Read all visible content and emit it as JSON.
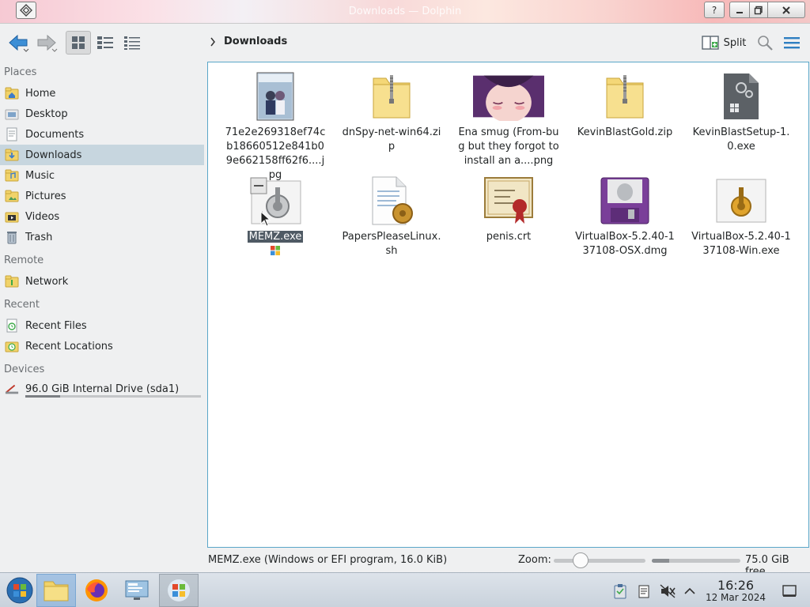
{
  "window": {
    "title": "Downloads — Dolphin"
  },
  "toolbar": {
    "breadcrumb": [
      "Downloads"
    ],
    "split_label": "Split"
  },
  "sidebar": {
    "sections": [
      {
        "title": "Places",
        "items": [
          "Home",
          "Desktop",
          "Documents",
          "Downloads",
          "Music",
          "Pictures",
          "Videos",
          "Trash"
        ]
      },
      {
        "title": "Remote",
        "items": [
          "Network"
        ]
      },
      {
        "title": "Recent",
        "items": [
          "Recent Files",
          "Recent Locations"
        ]
      },
      {
        "title": "Devices",
        "items": [
          "96.0 GiB Internal Drive (sda1)"
        ]
      }
    ],
    "active_item": "Downloads",
    "drive_usage_fraction": 0.2
  },
  "files": [
    {
      "name": "71e2e269318ef74cb18660512e841b09e662158ff62f6....jpg",
      "kind": "image-thumb"
    },
    {
      "name": "dnSpy-net-win64.zip",
      "kind": "zip"
    },
    {
      "name": "Ena smug (From-bug but they forgot to install an a....png",
      "kind": "anime-thumb"
    },
    {
      "name": "KevinBlastGold.zip",
      "kind": "zip"
    },
    {
      "name": "KevinBlastSetup-1.0.exe",
      "kind": "exe-gear"
    },
    {
      "name": "MEMZ.exe",
      "kind": "installer",
      "selected": true
    },
    {
      "name": "PapersPleaseLinux.sh",
      "kind": "script"
    },
    {
      "name": "penis.crt",
      "kind": "certificate"
    },
    {
      "name": "VirtualBox-5.2.40-137108-OSX.dmg",
      "kind": "dmg"
    },
    {
      "name": "VirtualBox-5.2.40-137108-Win.exe",
      "kind": "installer"
    }
  ],
  "status": {
    "text": "MEMZ.exe (Windows or EFI program, 16.0 KiB)",
    "zoom_label": "Zoom:",
    "free_space": "75.0 GiB free",
    "zoom_fraction": 0.29,
    "used_fraction": 0.2
  },
  "taskbar": {
    "time": "16:26",
    "date": "12 Mar 2024"
  },
  "colors": {
    "accent": "#5aa6c8",
    "selection": "#c7d6df"
  }
}
